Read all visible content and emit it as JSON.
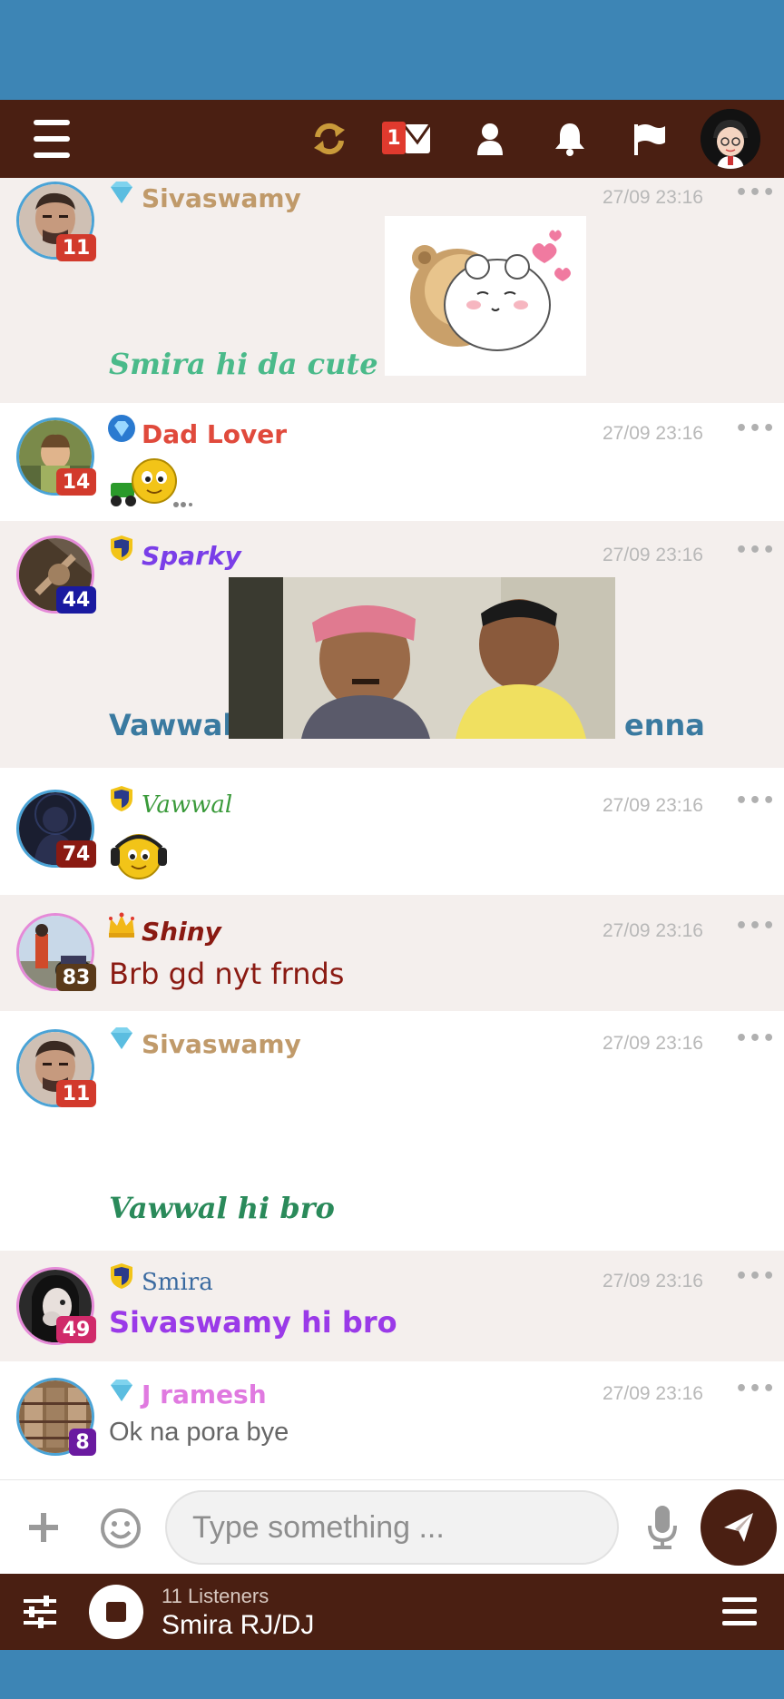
{
  "topbar": {
    "notification_count": "1",
    "icons": [
      "menu-icon",
      "refresh-icon",
      "mail-icon",
      "user-icon",
      "bell-icon",
      "flag-icon",
      "profile-avatar"
    ]
  },
  "messages": [
    {
      "username": "Sivaswamy",
      "rank_icon": "diamond-icon",
      "level": "11",
      "time": "27/09 23:16",
      "text": "Smira hi da cute sis",
      "attachment": "sticker-bear-hug",
      "colors": {
        "name": "#c09a6a",
        "text": "#4aba8a",
        "level": "#d23a2c"
      }
    },
    {
      "username": "Dad Lover",
      "rank_icon": "blue-gem-icon",
      "level": "14",
      "time": "27/09 23:16",
      "attachment": "emoji-scooter",
      "colors": {
        "name": "#e04a3c",
        "level": "#d23a2c"
      }
    },
    {
      "username": "Sparky",
      "rank_icon": "shield-icon",
      "level": "44",
      "time": "27/09 23:16",
      "text_before": "Vawwal",
      "text_after": "enna",
      "attachment": "gif-two-men",
      "colors": {
        "name": "#7a3ee8",
        "text": "#3a7aa0",
        "level": "#1a1aa0"
      }
    },
    {
      "username": "Vawwal",
      "rank_icon": "shield-icon",
      "level": "74",
      "time": "27/09 23:16",
      "attachment": "emoji-headphones",
      "colors": {
        "name": "#3a9a3a",
        "level": "#8a1a12"
      }
    },
    {
      "username": "Shiny",
      "rank_icon": "crown-icon",
      "level": "83",
      "time": "27/09 23:16",
      "text": "Brb gd nyt frnds",
      "colors": {
        "name": "#8a1a12",
        "text": "#8a1a12",
        "level": "#5a3a1a"
      }
    },
    {
      "username": "Sivaswamy",
      "rank_icon": "diamond-icon",
      "level": "11",
      "time": "27/09 23:16",
      "text": "Vawwal hi bro",
      "colors": {
        "name": "#c09a6a",
        "text": "#2a8a5a",
        "level": "#d23a2c"
      }
    },
    {
      "username": "Smira",
      "rank_icon": "shield-icon",
      "level": "49",
      "time": "27/09 23:16",
      "text": "Sivaswamy hi bro",
      "colors": {
        "name": "#3a6aa0",
        "text": "#9a3ae8",
        "level": "#d02a6a"
      }
    },
    {
      "username": "J ramesh",
      "rank_icon": "diamond-icon",
      "level": "8",
      "time": "27/09 23:16",
      "text": "Ok na pora bye",
      "colors": {
        "name": "#e07ae0",
        "text": "#666666",
        "level": "#6a1aa0"
      }
    }
  ],
  "composer": {
    "placeholder": "Type something ..."
  },
  "player": {
    "listeners": "11 Listeners",
    "station": "Smira RJ/DJ"
  }
}
